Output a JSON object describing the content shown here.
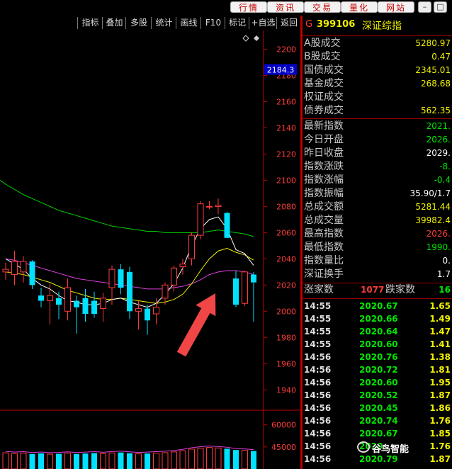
{
  "topbar": {
    "buttons": [
      "行情",
      "资讯",
      "交易",
      "量化",
      "网站"
    ],
    "window_controls": [
      "minimize-icon",
      "restore-icon"
    ]
  },
  "chart_toolbar": {
    "buttons": [
      "指标",
      "叠加",
      "多股",
      "统计",
      "画线",
      "F10",
      "标记",
      "+自选",
      "返回"
    ]
  },
  "price_scale": {
    "ticks": [
      "2200",
      "2180",
      "2160",
      "2140",
      "2120",
      "2100",
      "2080",
      "2060",
      "2040",
      "2020",
      "2000",
      "1980",
      "1960",
      "1940"
    ],
    "current_label": "2184.3"
  },
  "volume_scale": {
    "ticks": [
      "60000",
      "45000"
    ]
  },
  "colors": {
    "up": "#ff3c3c",
    "down": "#00e0ff",
    "ma5": "#ffffff",
    "ma10": "#f0f000",
    "ma20": "#e040e0",
    "ma60": "#00d000",
    "arrow": "#f04646",
    "grid_border": "#c00000"
  },
  "chart_data": {
    "type": "candlestick",
    "ylim": [
      1925,
      2210
    ],
    "candles": [
      {
        "o": 2030,
        "c": 2032,
        "h": 2037,
        "l": 2024
      },
      {
        "o": 2028,
        "c": 2038,
        "h": 2046,
        "l": 2020
      },
      {
        "o": 2030,
        "c": 2038,
        "h": 2042,
        "l": 2022
      },
      {
        "o": 2038,
        "c": 2020,
        "h": 2039,
        "l": 2017
      },
      {
        "o": 2012,
        "c": 2008,
        "h": 2018,
        "l": 2003
      },
      {
        "o": 2008,
        "c": 2012,
        "h": 2021,
        "l": 1990
      },
      {
        "o": 2010,
        "c": 2005,
        "h": 2015,
        "l": 1994
      },
      {
        "o": 2000,
        "c": 2018,
        "h": 2025,
        "l": 1993
      },
      {
        "o": 2008,
        "c": 2003,
        "h": 2012,
        "l": 1983
      },
      {
        "o": 2010,
        "c": 1998,
        "h": 2017,
        "l": 1992
      },
      {
        "o": 2008,
        "c": 1998,
        "h": 2015,
        "l": 1995
      },
      {
        "o": 2002,
        "c": 2010,
        "h": 2014,
        "l": 1992
      },
      {
        "o": 2018,
        "c": 2032,
        "h": 2035,
        "l": 2005
      },
      {
        "o": 2032,
        "c": 2018,
        "h": 2036,
        "l": 2013
      },
      {
        "o": 2030,
        "c": 2000,
        "h": 2034,
        "l": 1994
      },
      {
        "o": 2000,
        "c": 2002,
        "h": 2008,
        "l": 1986
      },
      {
        "o": 2002,
        "c": 1993,
        "h": 2005,
        "l": 1982
      },
      {
        "o": 1998,
        "c": 2003,
        "h": 2010,
        "l": 1990
      },
      {
        "o": 2010,
        "c": 2020,
        "h": 2022,
        "l": 2005
      },
      {
        "o": 2020,
        "c": 2033,
        "h": 2035,
        "l": 2015
      },
      {
        "o": 2034,
        "c": 2036,
        "h": 2040,
        "l": 2028
      },
      {
        "o": 2040,
        "c": 2058,
        "h": 2060,
        "l": 2035
      },
      {
        "o": 2058,
        "c": 2082,
        "h": 2084,
        "l": 2055
      },
      {
        "o": 2080,
        "c": 2080,
        "h": 2084,
        "l": 2078
      },
      {
        "o": 2080,
        "c": 2081,
        "h": 2086,
        "l": 2074
      },
      {
        "o": 2075,
        "c": 2056,
        "h": 2076,
        "l": 2056
      },
      {
        "o": 2025,
        "c": 2005,
        "h": 2031,
        "l": 2003
      },
      {
        "o": 2006,
        "c": 2030,
        "h": 2031,
        "l": 2004
      },
      {
        "o": 2028,
        "c": 2022,
        "h": 2030,
        "l": 1992
      }
    ],
    "ma5": [
      2040,
      2036,
      2032,
      2025,
      2020,
      2017,
      2012,
      2008,
      2007,
      2005,
      2005,
      2006,
      2009,
      2010,
      2007,
      2005,
      2003,
      2006,
      2013,
      2021,
      2033,
      2050,
      2063,
      2070,
      2072,
      2063,
      2047,
      2044,
      2035
    ],
    "ma10": [
      2030,
      2029,
      2028,
      2026,
      2024,
      2022,
      2019,
      2016,
      2014,
      2012,
      2010,
      2009,
      2009,
      2010,
      2009,
      2008,
      2007,
      2006,
      2007,
      2009,
      2013,
      2021,
      2031,
      2040,
      2046,
      2048,
      2045,
      2043,
      2039
    ],
    "ma20": [
      2040,
      2039,
      2037,
      2035,
      2033,
      2031,
      2029,
      2027,
      2025,
      2024,
      2023,
      2022,
      2021,
      2020,
      2019,
      2018,
      2017,
      2017,
      2017,
      2018,
      2019,
      2021,
      2024,
      2028,
      2030,
      2031,
      2031,
      2030,
      2028
    ],
    "ma60": [
      2097,
      2093,
      2089,
      2086,
      2083,
      2080,
      2077,
      2075,
      2073,
      2071,
      2069,
      2067,
      2065,
      2064,
      2063,
      2062,
      2061,
      2061,
      2060,
      2060,
      2060,
      2060,
      2060,
      2061,
      2062,
      2061,
      2060,
      2059,
      2057
    ],
    "volume_ylim": [
      30000,
      68000
    ],
    "volumes": [
      41000,
      40500,
      40800,
      40200,
      40600,
      40100,
      40300,
      40700,
      40200,
      40500,
      40800,
      40400,
      40900,
      41200,
      40700,
      40300,
      40500,
      40800,
      41100,
      41600,
      42400,
      43500,
      44200,
      44600,
      44300,
      43800,
      42900,
      42600,
      42200
    ]
  },
  "info_panel": {
    "header_tag": "G",
    "code": "399106",
    "name": "深证综指",
    "rows": [
      {
        "label": "A股成交",
        "value": "5280.97"
      },
      {
        "label": "B股成交",
        "value": "0.47"
      },
      {
        "label": "国债成交",
        "value": "2345.01"
      },
      {
        "label": "基金成交",
        "value": "268.68"
      },
      {
        "label": "权证成交",
        "value": ""
      },
      {
        "label": "债券成交",
        "value": "562.35"
      }
    ],
    "rows2": [
      {
        "label": "最新指数",
        "value": "2021."
      },
      {
        "label": "今日开盘",
        "value": "2026."
      },
      {
        "label": "昨日收盘",
        "value": "2029."
      },
      {
        "label": "指数涨跌",
        "value": "-8."
      },
      {
        "label": "指数涨幅",
        "value": "-0.4"
      },
      {
        "label": "指数振幅",
        "value": "35.90/1.7"
      },
      {
        "label": "总成交额",
        "value": "5281.44"
      },
      {
        "label": "总成交量",
        "value": "39982.4"
      },
      {
        "label": "最高指数",
        "value": "2026."
      },
      {
        "label": "最低指数",
        "value": "1990."
      },
      {
        "label": "指数量比",
        "value": "0."
      },
      {
        "label": "深证换手",
        "value": "1.7"
      }
    ],
    "breadth": {
      "up_label": "涨家数",
      "up_value": "1077",
      "down_label": "跌家数",
      "down_value": "16"
    },
    "ticks": [
      {
        "time": "14:55",
        "price": "2020.67",
        "vol": "1.65"
      },
      {
        "time": "14:55",
        "price": "2020.66",
        "vol": "1.49"
      },
      {
        "time": "14:55",
        "price": "2020.64",
        "vol": "1.47"
      },
      {
        "time": "14:55",
        "price": "2020.60",
        "vol": "1.41"
      },
      {
        "time": "14:56",
        "price": "2020.76",
        "vol": "1.38"
      },
      {
        "time": "14:56",
        "price": "2020.72",
        "vol": "1.81"
      },
      {
        "time": "14:56",
        "price": "2020.60",
        "vol": "1.95"
      },
      {
        "time": "14:56",
        "price": "2020.52",
        "vol": "1.87"
      },
      {
        "time": "14:56",
        "price": "2020.45",
        "vol": "1.86"
      },
      {
        "time": "14:56",
        "price": "2020.74",
        "vol": "1.76"
      },
      {
        "time": "14:56",
        "price": "2020.67",
        "vol": "1.85"
      },
      {
        "time": "14:56",
        "price": "2020.",
        "vol": "1.76"
      },
      {
        "time": "14:56",
        "price": "2020.79",
        "vol": "1.87"
      }
    ]
  },
  "watermark": "谷鸟智能"
}
